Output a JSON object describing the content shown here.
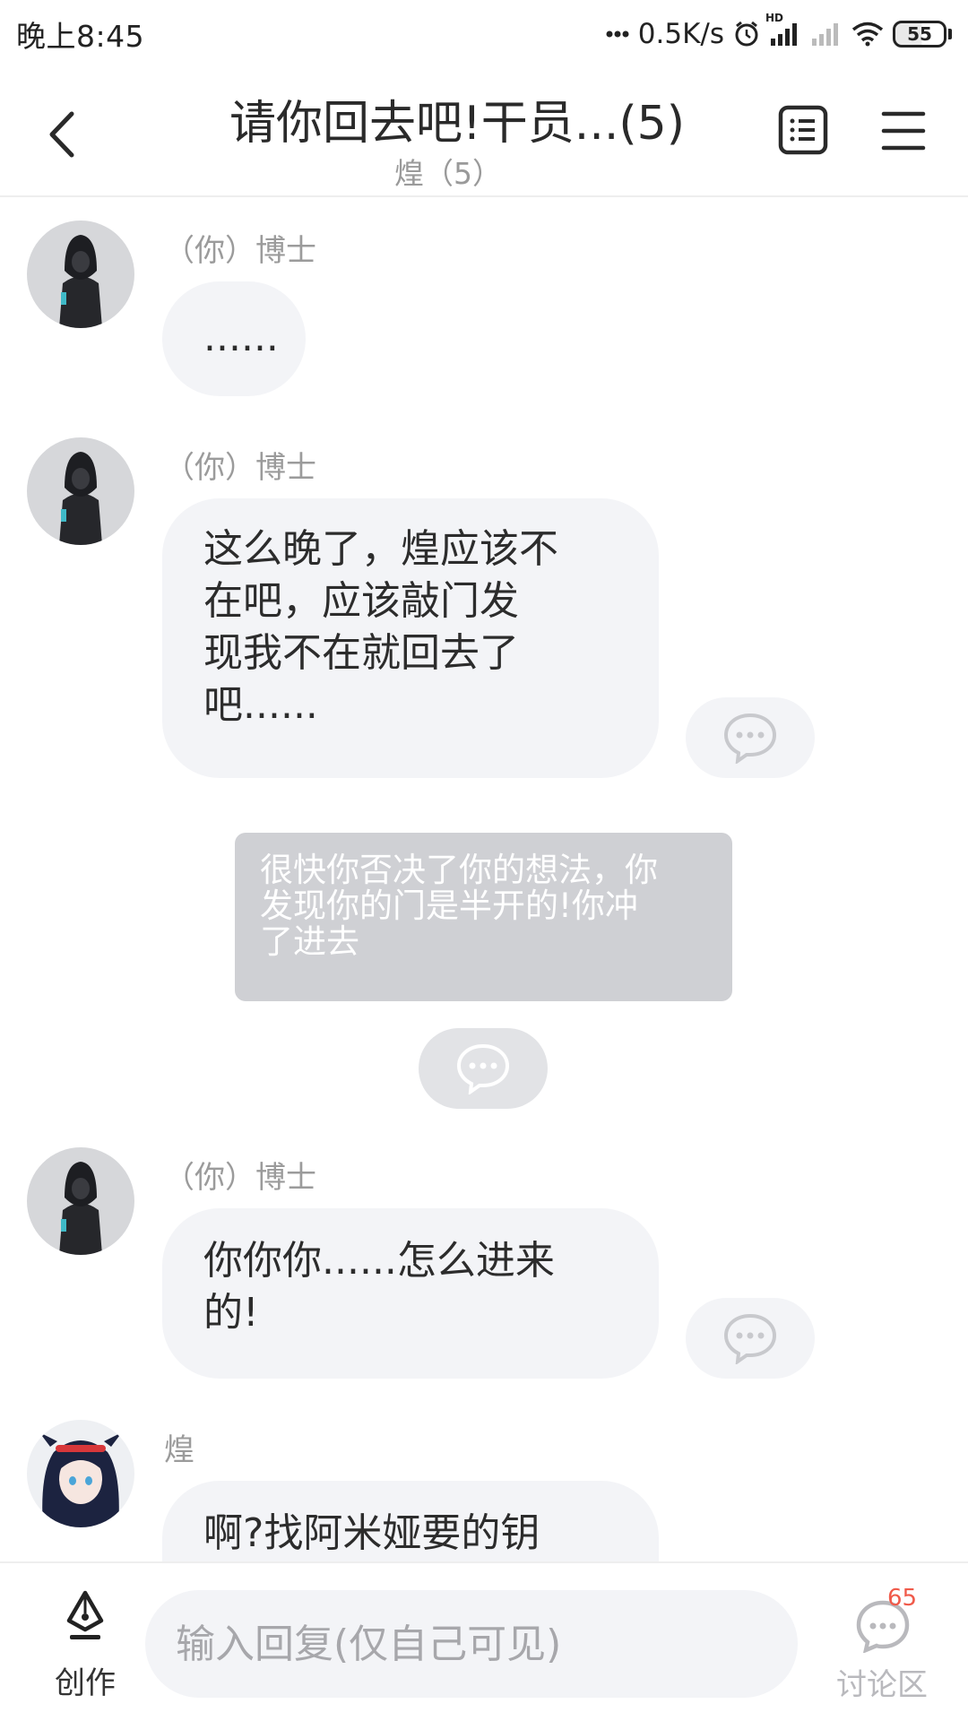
{
  "status_bar": {
    "time": "晚上8:45",
    "network_speed": "0.5K/s",
    "signal_label": "HD",
    "battery_level": "55",
    "icons": [
      "dots-icon",
      "alarm-icon",
      "signal-icon",
      "signal-weak-icon",
      "wifi-icon",
      "battery-icon"
    ]
  },
  "header": {
    "title": "请你回去吧!干员...(5)",
    "subtitle": "煌（5）",
    "back_icon": "chevron-left-icon",
    "list_icon": "list-icon",
    "menu_icon": "menu-icon"
  },
  "messages": [
    {
      "sender": "（你）博士",
      "text": "......",
      "has_comment_button": false
    },
    {
      "sender": "（你）博士",
      "text": "这么晚了，煌应该不\n在吧，应该敲门发\n现我不在就回去了\n吧......",
      "has_comment_button": true
    },
    {
      "type": "narration",
      "text": "很快你否决了你的想法，你\n发现你的门是半开的!你冲\n了进去",
      "has_comment_button": true
    },
    {
      "sender": "（你）博士",
      "text": "你你你......怎么进来\n的!",
      "has_comment_button": true
    },
    {
      "sender": "煌",
      "text": "啊?找阿米娅要的钥",
      "has_comment_button": false
    }
  ],
  "bottom_bar": {
    "create_label": "创作",
    "input_placeholder": "输入回复(仅自己可见)",
    "discussion_label": "讨论区",
    "discussion_count": "65"
  },
  "colors": {
    "bubble_bg": "#f3f4f7",
    "narration_bg": "#cfd0d4",
    "badge_red": "#f05a4a",
    "muted_text": "#9b9b9b"
  }
}
